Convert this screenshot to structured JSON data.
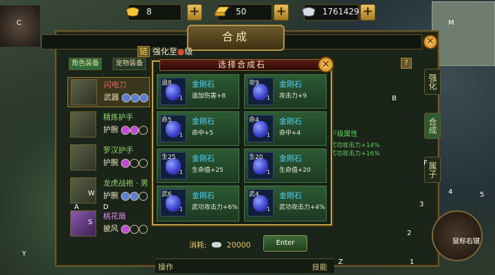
{
  "currency": {
    "gold": "8",
    "gold_bar": "50",
    "silver": "1761429"
  },
  "window": {
    "title": "合成",
    "strengthen": {
      "tag": "链",
      "text": "强化至",
      "suffix": "级"
    },
    "tabs": [
      "角色装备",
      "宠物装备"
    ],
    "side_tabs": [
      "强化",
      "合成",
      "属子"
    ],
    "help": "?",
    "next_attr_label": "下级属性",
    "next_attr_lines": [
      "武功攻击力+14%",
      "武功攻击力+16%"
    ],
    "consume_label": "消耗:",
    "consume_value": "20000",
    "enter_label": "Enter"
  },
  "equipment": [
    {
      "name": "闪电刀",
      "type": "武器",
      "color": "red"
    },
    {
      "name": "精炼护手",
      "type": "护腕",
      "color": "green"
    },
    {
      "name": "罗汉护手",
      "type": "护腕",
      "color": "green"
    },
    {
      "name": "龙虎战袍 · 男",
      "type": "护腕",
      "color": "green"
    },
    {
      "name": "桃花扇",
      "type": "披风",
      "color": "pink"
    }
  ],
  "popup": {
    "title": "选择合成石",
    "stones": [
      {
        "level": "追8",
        "count": "1",
        "name": "金刚石",
        "effect": "追加伤害+8"
      },
      {
        "level": "攻9",
        "count": "1",
        "name": "金刚石",
        "effect": "攻击力+9"
      },
      {
        "level": "命5",
        "count": "1",
        "name": "金刚石",
        "effect": "命中+5"
      },
      {
        "level": "命4",
        "count": "1",
        "name": "金刚石",
        "effect": "命中+4"
      },
      {
        "level": "生25",
        "count": "1",
        "name": "金刚石",
        "effect": "生命值+25"
      },
      {
        "level": "生20",
        "count": "1",
        "name": "金刚石",
        "effect": "生命值+20"
      },
      {
        "level": "武6",
        "count": "1",
        "name": "金刚石",
        "effect": "武功攻击力+6%"
      },
      {
        "level": "武4",
        "count": "1",
        "name": "金刚石",
        "effect": "武功攻击力+4%"
      }
    ]
  },
  "hud": {
    "keys": [
      "C",
      "M",
      "B",
      "F",
      "W",
      "A",
      "D",
      "S",
      "4",
      "5",
      "3",
      "2",
      "1",
      "Y",
      "Z"
    ],
    "mouse_label": "鼠标右键",
    "bottom_left": "操作",
    "bottom_right": "技能"
  }
}
